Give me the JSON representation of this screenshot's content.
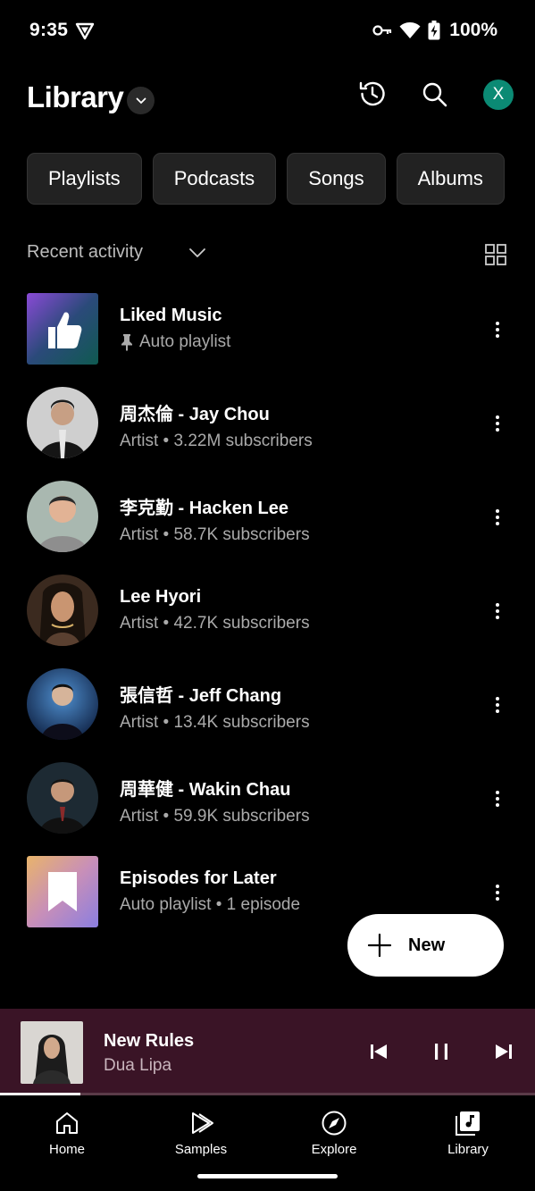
{
  "status_bar": {
    "time": "9:35",
    "battery": "100%",
    "icons": [
      "vpn-icon",
      "key-icon",
      "wifi-icon",
      "battery-charging-icon"
    ]
  },
  "header": {
    "title": "Library",
    "avatar_letter": "X",
    "avatar_color": "#0b8a74"
  },
  "chips": [
    "Playlists",
    "Podcasts",
    "Songs",
    "Albums"
  ],
  "sort": {
    "label": "Recent activity"
  },
  "items": [
    {
      "title": "Liked Music",
      "subtitle": "Auto playlist",
      "pinned": true,
      "shape": "square",
      "art": "liked"
    },
    {
      "title": "周杰倫 - Jay Chou",
      "subtitle": "Artist • 3.22M subscribers",
      "shape": "round",
      "art": "artist1"
    },
    {
      "title": "李克勤 - Hacken Lee",
      "subtitle": "Artist • 58.7K subscribers",
      "shape": "round",
      "art": "artist2"
    },
    {
      "title": "Lee Hyori",
      "subtitle": "Artist • 42.7K subscribers",
      "shape": "round",
      "art": "artist3"
    },
    {
      "title": "張信哲 - Jeff Chang",
      "subtitle": "Artist • 13.4K subscribers",
      "shape": "round",
      "art": "artist4"
    },
    {
      "title": "周華健 - Wakin Chau",
      "subtitle": "Artist • 59.9K subscribers",
      "shape": "round",
      "art": "artist5"
    },
    {
      "title": "Episodes for Later",
      "subtitle": "Auto playlist • 1 episode",
      "shape": "square",
      "art": "episodes"
    }
  ],
  "fab": {
    "label": "New"
  },
  "player": {
    "title": "New Rules",
    "artist": "Dua Lipa",
    "progress": 0.15,
    "background": "#3a1426"
  },
  "nav": [
    {
      "label": "Home",
      "icon": "home-icon",
      "active": false
    },
    {
      "label": "Samples",
      "icon": "samples-icon",
      "active": false
    },
    {
      "label": "Explore",
      "icon": "explore-icon",
      "active": false
    },
    {
      "label": "Library",
      "icon": "library-icon",
      "active": true
    }
  ]
}
